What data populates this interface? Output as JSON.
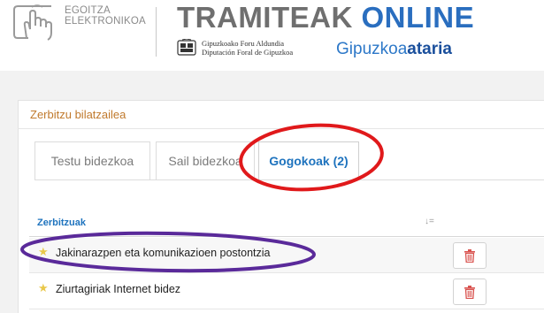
{
  "header": {
    "egoitza_line1": "EGOITZA",
    "egoitza_line2": "ELEKTRONIKOA",
    "title_part1": "TRAMITEAK ",
    "title_part2": "ONLINE",
    "dfg_line1": "Gipuzkoako Foru Aldundia",
    "dfg_line2": "Diputación Foral de Gipuzkoa",
    "brand_part1": "Gipuzkoa",
    "brand_part2": "ataria"
  },
  "search": {
    "title": "Zerbitzu bilatzailea",
    "tabs": [
      {
        "label": "Testu bidezkoa",
        "active": false
      },
      {
        "label": "Sail bidezkoa",
        "active": false
      },
      {
        "label": "Gogokoak (2)",
        "active": true
      }
    ]
  },
  "table": {
    "header": "Zerbitzuak",
    "sort_icon": "sort-icon",
    "rows": [
      {
        "label": "Jakinarazpen eta komunikazioen postontzia",
        "icon": "star-icon",
        "action_icon": "trash-icon"
      },
      {
        "label": "Ziurtagiriak Internet bidez",
        "icon": "star-icon",
        "action_icon": "trash-icon"
      }
    ]
  },
  "colors": {
    "accent_blue": "#1e73be",
    "title_orange": "#c0792c",
    "delete_red": "#d9534f",
    "annotation_red": "#e0191b",
    "annotation_purple": "#5a2a9a"
  }
}
